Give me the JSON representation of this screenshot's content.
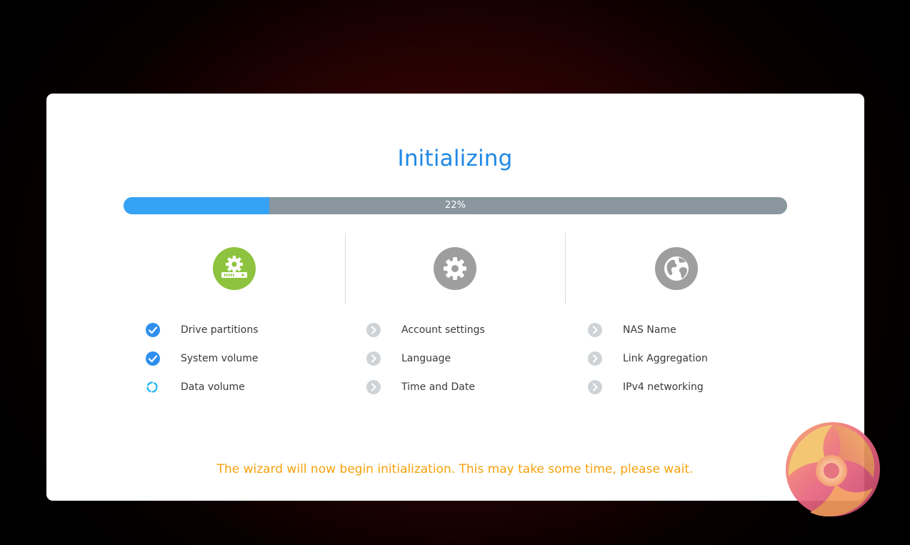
{
  "wizard": {
    "title": "Initializing",
    "progress": {
      "percent": 22,
      "label": "22%"
    },
    "footer_message": "The wizard will now begin initialization. This may take some time, please wait."
  },
  "stages": [
    {
      "name": "storage",
      "icon": "drive-gear-icon",
      "state": "active",
      "color": "#8dc33e",
      "steps": [
        {
          "label": "Drive partitions",
          "status": "done"
        },
        {
          "label": "System volume",
          "status": "done"
        },
        {
          "label": "Data volume",
          "status": "in-progress"
        }
      ]
    },
    {
      "name": "system",
      "icon": "gear-icon",
      "state": "pending",
      "color": "#9e9e9e",
      "steps": [
        {
          "label": "Account settings",
          "status": "pending"
        },
        {
          "label": "Language",
          "status": "pending"
        },
        {
          "label": "Time and Date",
          "status": "pending"
        }
      ]
    },
    {
      "name": "network",
      "icon": "globe-icon",
      "state": "pending",
      "color": "#9e9e9e",
      "steps": [
        {
          "label": "NAS Name",
          "status": "pending"
        },
        {
          "label": "Link Aggregation",
          "status": "pending"
        },
        {
          "label": "IPv4 networking",
          "status": "pending"
        }
      ]
    }
  ],
  "colors": {
    "accent_blue": "#1e88e5",
    "progress_fill": "#35a2f5",
    "progress_track": "#8a979f",
    "check_blue": "#2f8fee",
    "spinner": "#29b6f6",
    "pending_grey": "#cfd3d6",
    "warning_orange": "#f5a10b"
  }
}
